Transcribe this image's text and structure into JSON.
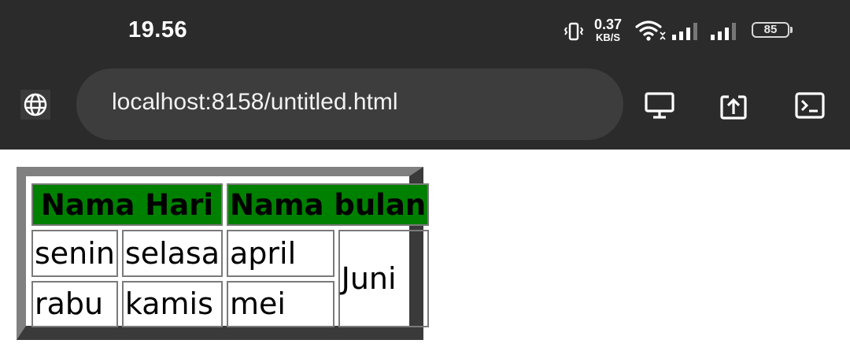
{
  "status_bar": {
    "time": "19.56",
    "net_speed_value": "0.37",
    "net_speed_unit": "KB/S",
    "battery_level": "85",
    "icons": [
      "vibrate-icon",
      "wifi-icon",
      "signal-icon",
      "signal-icon",
      "battery-icon"
    ]
  },
  "browser": {
    "site_icon": "globe-icon",
    "url": "localhost:8158/untitled.html",
    "toolbar_icons": [
      "desktop-icon",
      "share-icon",
      "console-icon"
    ]
  },
  "table": {
    "headers": [
      "Nama Hari",
      "Nama bulan"
    ],
    "header_color": "#008000",
    "rows": [
      [
        "senin",
        "selasa",
        "april"
      ],
      [
        "rabu",
        "kamis",
        "mei"
      ]
    ],
    "merged_cell": "Juni"
  }
}
